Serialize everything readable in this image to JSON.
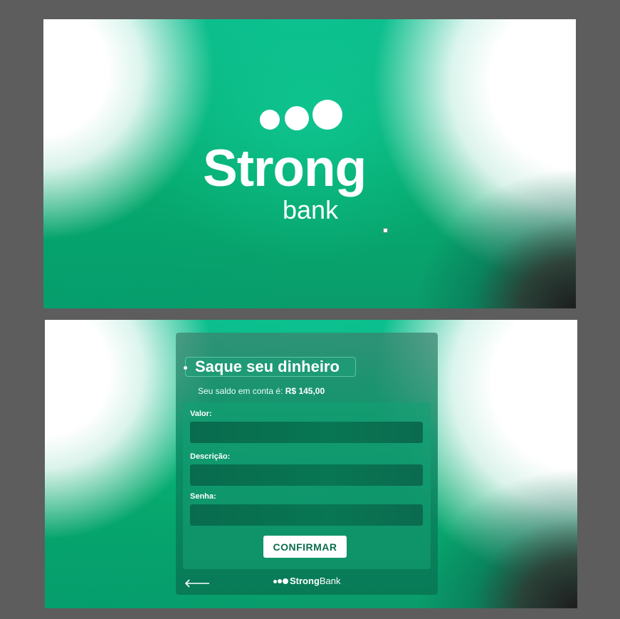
{
  "splash": {
    "brand_strong": "Strong",
    "brand_bank": "bank",
    "logo_dots_icon": "three-dots-logo-icon"
  },
  "withdraw": {
    "title": "Saque seu dinheiro",
    "balance_prefix": "Seu saldo em conta é:",
    "balance_amount": "R$ 145,00",
    "fields": {
      "valor_label": "Valor:",
      "valor_value": "",
      "descricao_label": "Descrição:",
      "descricao_value": "",
      "senha_label": "Senha:",
      "senha_value": ""
    },
    "confirm_label": "CONFIRMAR",
    "back_icon": "arrow-left-icon",
    "footer_strong": "Strong",
    "footer_bank": "Bank"
  },
  "colors": {
    "brand_green": "#06ab6f",
    "dark_green": "#086b4d",
    "button_text": "#0b6d4e",
    "page_background": "#5d5d5d"
  }
}
